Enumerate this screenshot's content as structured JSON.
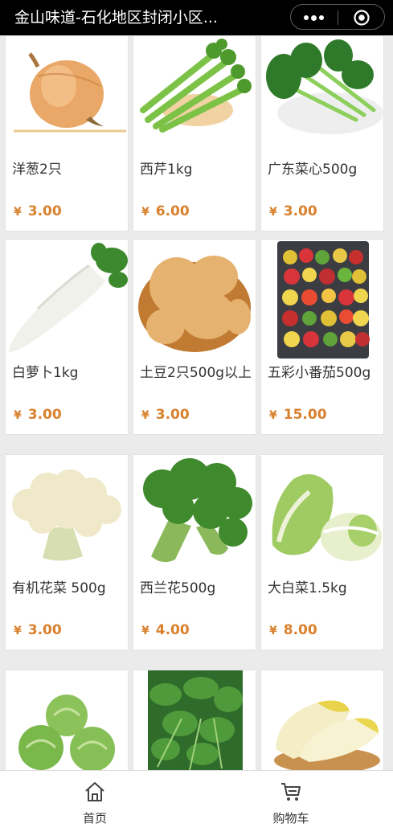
{
  "window": {
    "title": "金山味道-石化地区封闭小区..."
  },
  "currency_symbol": "¥",
  "products": [
    {
      "name": "洋葱2只",
      "price": "3.00",
      "image": "onion"
    },
    {
      "name": "西芹1kg",
      "price": "6.00",
      "image": "celery"
    },
    {
      "name": "广东菜心500g",
      "price": "3.00",
      "image": "choy-sum"
    },
    {
      "name": "白萝卜1kg",
      "price": "3.00",
      "image": "white-radish"
    },
    {
      "name": "土豆2只500g以上",
      "price": "3.00",
      "image": "potatoes"
    },
    {
      "name": "五彩小番茄500g",
      "price": "15.00",
      "image": "cherry-tomatoes"
    },
    {
      "name": "有机花菜 500g",
      "price": "3.00",
      "image": "cauliflower"
    },
    {
      "name": "西兰花500g",
      "price": "4.00",
      "image": "broccoli"
    },
    {
      "name": "大白菜1.5kg",
      "price": "8.00",
      "image": "napa-cabbage"
    },
    {
      "name": "",
      "price": "",
      "image": "cabbages"
    },
    {
      "name": "",
      "price": "",
      "image": "spinach"
    },
    {
      "name": "",
      "price": "",
      "image": "baby-cabbage"
    }
  ],
  "tabbar": {
    "items": [
      {
        "label": "首页",
        "icon": "home-icon"
      },
      {
        "label": "购物车",
        "icon": "cart-icon"
      }
    ]
  },
  "colors": {
    "price": "#d9802c",
    "titlebar": "#000000"
  }
}
